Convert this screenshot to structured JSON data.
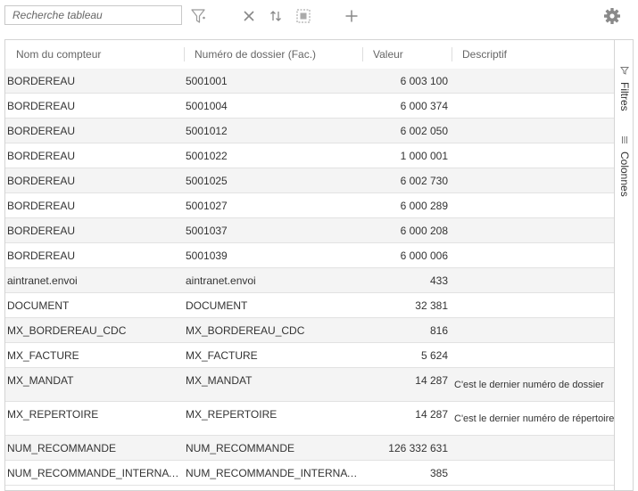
{
  "toolbar": {
    "search_placeholder": "Recherche tableau",
    "icons": [
      "filter-icon",
      "close-icon",
      "sort-icon",
      "select-all-icon",
      "add-icon",
      "gear-icon"
    ]
  },
  "columns": [
    "Nom du compteur",
    "Numéro de dossier (Fac.)",
    "Valeur",
    "Descriptif"
  ],
  "rows": [
    {
      "nom": "BORDEREAU",
      "dossier": "5001001",
      "valeur": "6 003 100",
      "descriptif": ""
    },
    {
      "nom": "BORDEREAU",
      "dossier": "5001004",
      "valeur": "6 000 374",
      "descriptif": ""
    },
    {
      "nom": "BORDEREAU",
      "dossier": "5001012",
      "valeur": "6 002 050",
      "descriptif": ""
    },
    {
      "nom": "BORDEREAU",
      "dossier": "5001022",
      "valeur": "1 000 001",
      "descriptif": ""
    },
    {
      "nom": "BORDEREAU",
      "dossier": "5001025",
      "valeur": "6 002 730",
      "descriptif": ""
    },
    {
      "nom": "BORDEREAU",
      "dossier": "5001027",
      "valeur": "6 000 289",
      "descriptif": ""
    },
    {
      "nom": "BORDEREAU",
      "dossier": "5001037",
      "valeur": "6 000 208",
      "descriptif": ""
    },
    {
      "nom": "BORDEREAU",
      "dossier": "5001039",
      "valeur": "6 000 006",
      "descriptif": ""
    },
    {
      "nom": "aintranet.envoi",
      "dossier": "aintranet.envoi",
      "valeur": "433",
      "descriptif": ""
    },
    {
      "nom": "DOCUMENT",
      "dossier": "DOCUMENT",
      "valeur": "32 381",
      "descriptif": ""
    },
    {
      "nom": "MX_BORDEREAU_CDC",
      "dossier": "MX_BORDEREAU_CDC",
      "valeur": "816",
      "descriptif": ""
    },
    {
      "nom": "MX_FACTURE",
      "dossier": "MX_FACTURE",
      "valeur": "5 624",
      "descriptif": ""
    },
    {
      "nom": "MX_MANDAT",
      "dossier": "MX_MANDAT",
      "valeur": "14 287",
      "descriptif": "C'est le dernier numéro de dossier"
    },
    {
      "nom": "MX_REPERTOIRE",
      "dossier": "MX_REPERTOIRE",
      "valeur": "14 287",
      "descriptif": "C'est le dernier numéro de répertoire"
    },
    {
      "nom": "NUM_RECOMMANDE",
      "dossier": "NUM_RECOMMANDE",
      "valeur": "126 332 631",
      "descriptif": ""
    },
    {
      "nom": "NUM_RECOMMANDE_INTERNATIONAL",
      "dossier": "NUM_RECOMMANDE_INTERNATIONAL",
      "valeur": "385",
      "descriptif": ""
    }
  ],
  "side_panel": {
    "filters_label": "Filtres",
    "columns_label": "Colonnes"
  }
}
